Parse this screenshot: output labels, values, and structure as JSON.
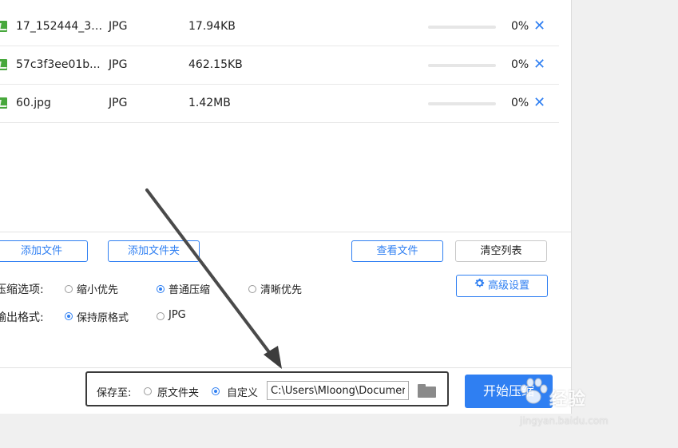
{
  "files": [
    {
      "name": "17_152444_3.j...",
      "type": "JPG",
      "size": "17.94KB",
      "progress": 0,
      "progress_label": "0%"
    },
    {
      "name": "57c3f3ee01b...",
      "type": "JPG",
      "size": "462.15KB",
      "progress": 0,
      "progress_label": "0%"
    },
    {
      "name": "60.jpg",
      "type": "JPG",
      "size": "1.42MB",
      "progress": 0,
      "progress_label": "0%"
    }
  ],
  "remove_glyph": "✕",
  "buttons": {
    "add_file": "添加文件",
    "add_folder": "添加文件夹",
    "view_files": "查看文件",
    "clear_list": "清空列表",
    "advanced": "高级设置",
    "start": "开始压缩"
  },
  "compress": {
    "label": "压缩选项:",
    "options": [
      "缩小优先",
      "普通压缩",
      "清晰优先"
    ],
    "selected": "普通压缩"
  },
  "output": {
    "label": "输出格式:",
    "options": [
      "保持原格式",
      "JPG"
    ],
    "selected": "保持原格式"
  },
  "save": {
    "label": "保存至:",
    "options": [
      "原文件夹",
      "自定义"
    ],
    "selected": "自定义",
    "path": "C:\\Users\\Mloong\\Documents"
  },
  "watermark": {
    "text": "经验",
    "url": "jingyan.baidu.com"
  },
  "colors": {
    "accent": "#2f7ff2",
    "file_icon": "#47a83c",
    "annotation_arrow": "#4a4a4a"
  }
}
